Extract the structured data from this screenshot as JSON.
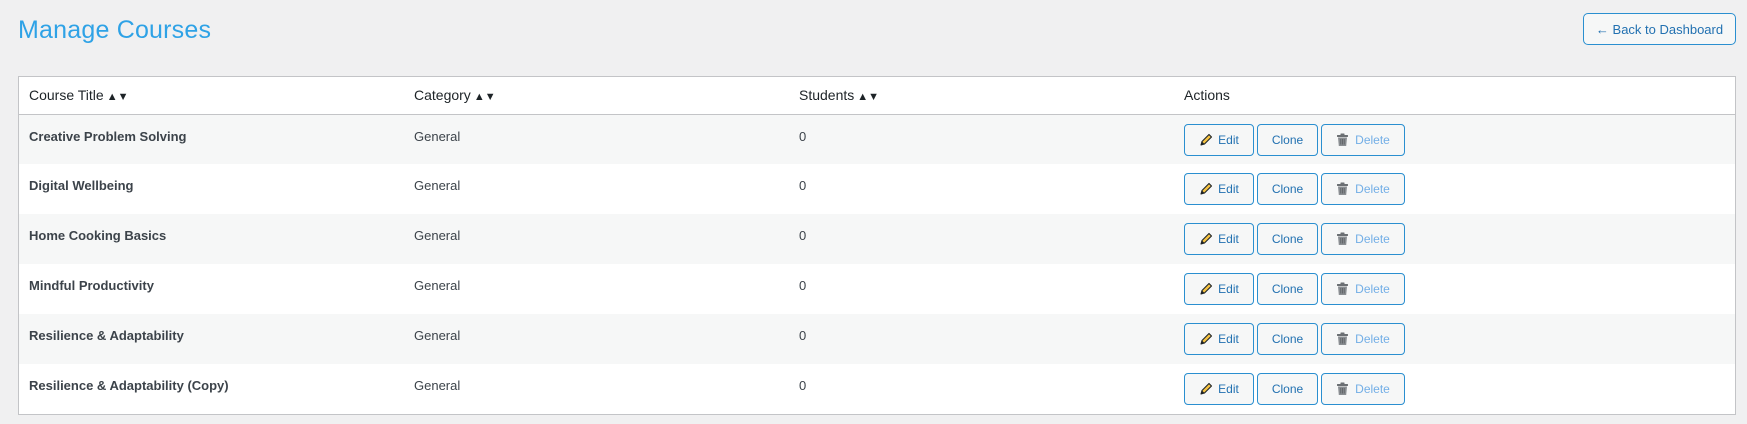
{
  "header": {
    "title": "Manage Courses",
    "back_label": "← Back to Dashboard"
  },
  "table": {
    "columns": [
      {
        "label": "Course Title",
        "sort_icon": "▲▼"
      },
      {
        "label": "Category",
        "sort_icon": "▲▼"
      },
      {
        "label": "Students",
        "sort_icon": "▲▼"
      },
      {
        "label": "Actions"
      }
    ],
    "rows": [
      {
        "title": "Creative Problem Solving",
        "category": "General",
        "students": "0"
      },
      {
        "title": "Digital Wellbeing",
        "category": "General",
        "students": "0"
      },
      {
        "title": "Home Cooking Basics",
        "category": "General",
        "students": "0"
      },
      {
        "title": "Mindful Productivity",
        "category": "General",
        "students": "0"
      },
      {
        "title": "Resilience & Adaptability",
        "category": "General",
        "students": "0"
      },
      {
        "title": "Resilience & Adaptability (Copy)",
        "category": "General",
        "students": "0"
      }
    ],
    "actions": {
      "edit_label": "Edit",
      "edit_icon": "pencil-icon",
      "clone_label": "Clone",
      "delete_label": "Delete",
      "delete_icon": "trash-icon"
    }
  },
  "colors": {
    "accent": "#2ea2e6",
    "button_border": "#2a8fd0",
    "delete_text": "#72aee6"
  }
}
